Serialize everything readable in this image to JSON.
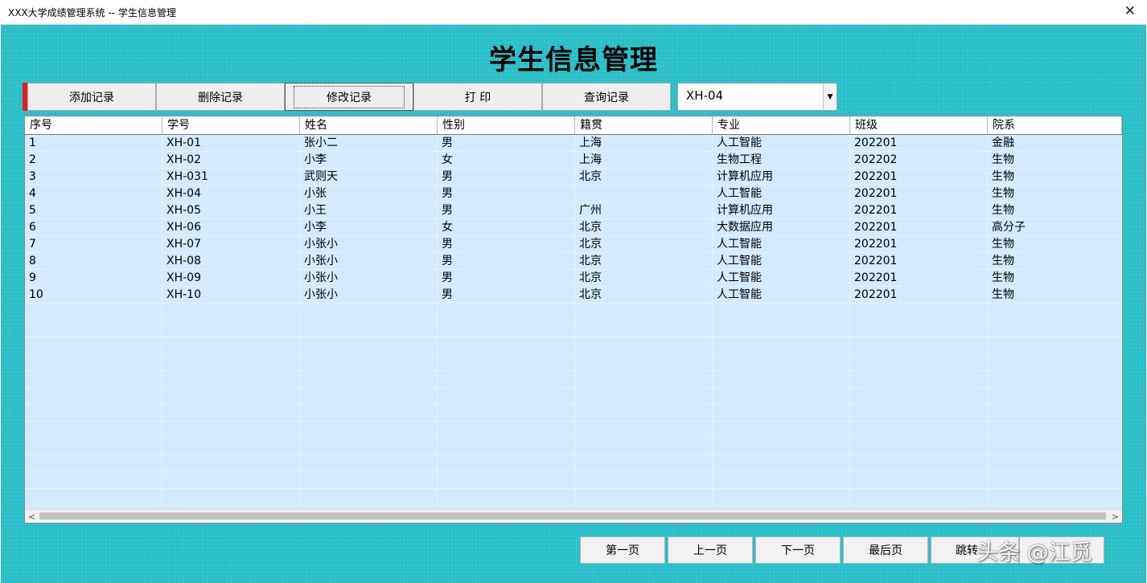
{
  "window": {
    "title": "XXX大学成绩管理系统 -- 学生信息管理",
    "close_glyph": "✕"
  },
  "heading": "学生信息管理",
  "toolbar": {
    "add_label": "添加记录",
    "delete_label": "删除记录",
    "edit_label": "修改记录",
    "print_label": "打 印",
    "query_label": "查询记录"
  },
  "student_select": {
    "value": "XH-04",
    "arrow": "▼"
  },
  "table": {
    "columns": [
      "序号",
      "学号",
      "姓名",
      "性别",
      "籍贯",
      "专业",
      "班级",
      "院系"
    ],
    "rows": [
      [
        "1",
        "XH-01",
        "张小二",
        "男",
        "上海",
        "人工智能",
        "202201",
        "金融"
      ],
      [
        "2",
        "XH-02",
        "小李",
        "女",
        "上海",
        "生物工程",
        "202202",
        "生物"
      ],
      [
        "3",
        "XH-031",
        "武则天",
        "男",
        "北京",
        "计算机应用",
        "202201",
        "生物"
      ],
      [
        "4",
        "XH-04",
        "小张",
        "男",
        "",
        "人工智能",
        "202201",
        "生物"
      ],
      [
        "5",
        "XH-05",
        "小王",
        "男",
        "广州",
        "计算机应用",
        "202201",
        "生物"
      ],
      [
        "6",
        "XH-06",
        "小李",
        "女",
        "北京",
        "大数据应用",
        "202201",
        "高分子"
      ],
      [
        "7",
        "XH-07",
        "小张小",
        "男",
        "北京",
        "人工智能",
        "202201",
        "生物"
      ],
      [
        "8",
        "XH-08",
        "小张小",
        "男",
        "北京",
        "人工智能",
        "202201",
        "生物"
      ],
      [
        "9",
        "XH-09",
        "小张小",
        "男",
        "北京",
        "人工智能",
        "202201",
        "生物"
      ],
      [
        "10",
        "XH-10",
        "小张小",
        "男",
        "北京",
        "人工智能",
        "202201",
        "生物"
      ]
    ],
    "scroll_left": "<",
    "scroll_right": ">"
  },
  "pager": {
    "first": "第一页",
    "prev": "上一页",
    "next": "下一页",
    "last": "最后页",
    "jump": "跳转"
  },
  "watermark": "头条 @江觅",
  "colors": {
    "background": "#25bfc9",
    "grid_rows": "#d3ebfc",
    "marker": "#e21b1b"
  }
}
